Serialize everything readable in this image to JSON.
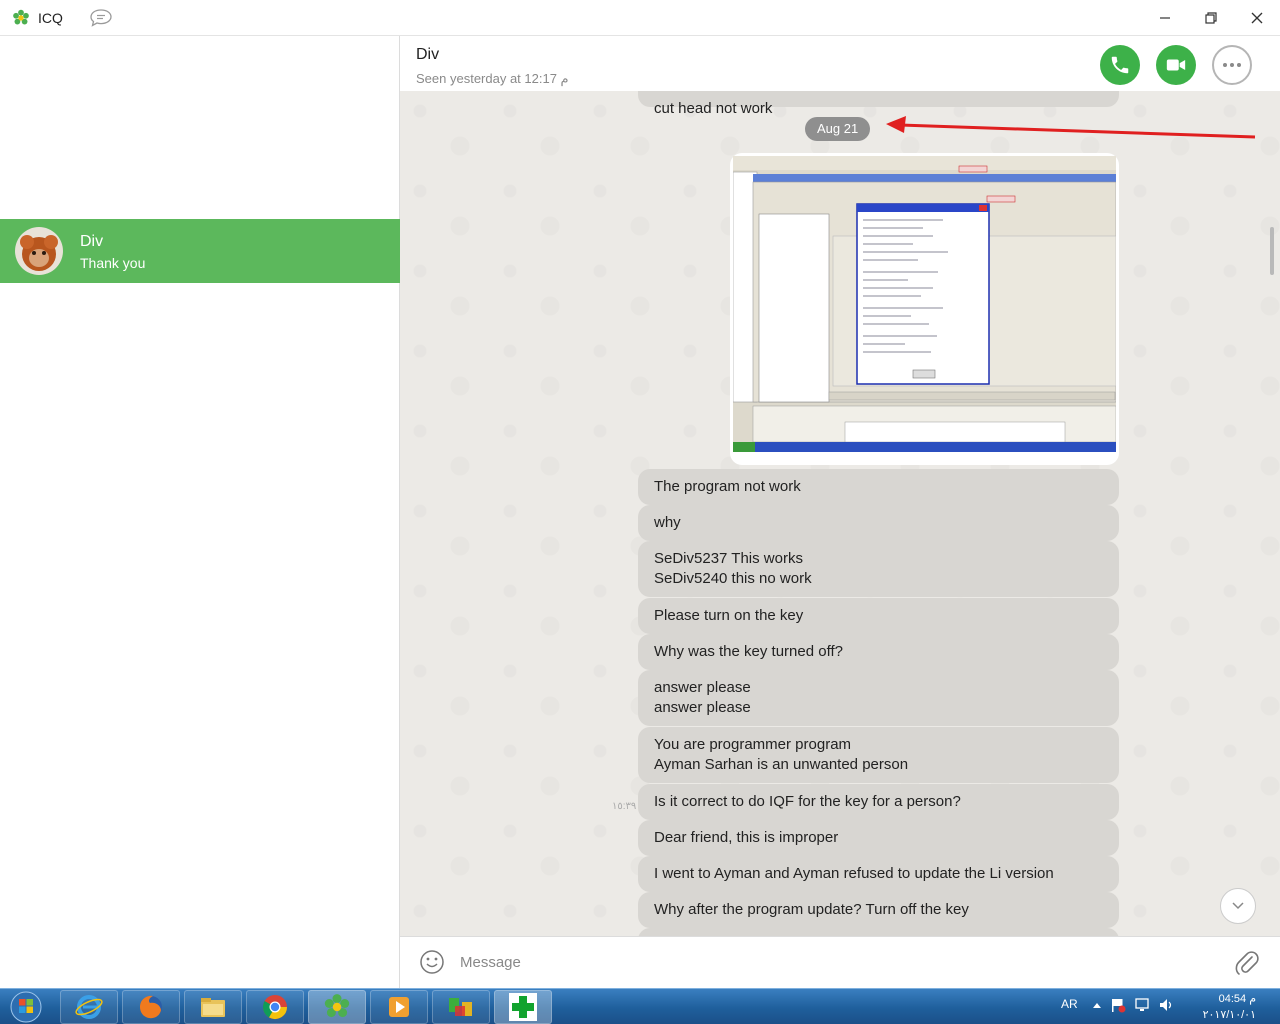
{
  "app": {
    "title": "ICQ"
  },
  "sidebar": {
    "contacts": [
      {
        "name": "Div",
        "preview": "Thank you",
        "selected": true
      }
    ]
  },
  "chat": {
    "title": "Div",
    "status": "Seen yesterday at 12:17 م",
    "partial_top_message": "cut head not work",
    "date_separator": "Aug 21",
    "side_time": "١٥:٣٩",
    "messages": [
      "The program  not work",
      "why",
      "SeDiv5237 This works\n SeDiv5240 this no work",
      "Please turn on the key",
      "Why was the key turned off?",
      "answer please\nanswer please",
      "You are programmer program\nAyman Sarhan is an unwanted person",
      "Is it correct to do IQF for the key for a person?",
      "Dear friend, this is improper",
      "I went to Ayman and Ayman refused to update the Li version",
      "Why after the program update? Turn off the key"
    ]
  },
  "composer": {
    "placeholder": "Message"
  },
  "taskbar": {
    "language": "AR",
    "time": "04:54 م",
    "date": "٢٠١٧/١٠/٠١"
  },
  "colors": {
    "accent": "#5cb85c",
    "call": "#3db149",
    "bubble": "#d8d6d2",
    "date_badge": "#8f8f8f"
  }
}
